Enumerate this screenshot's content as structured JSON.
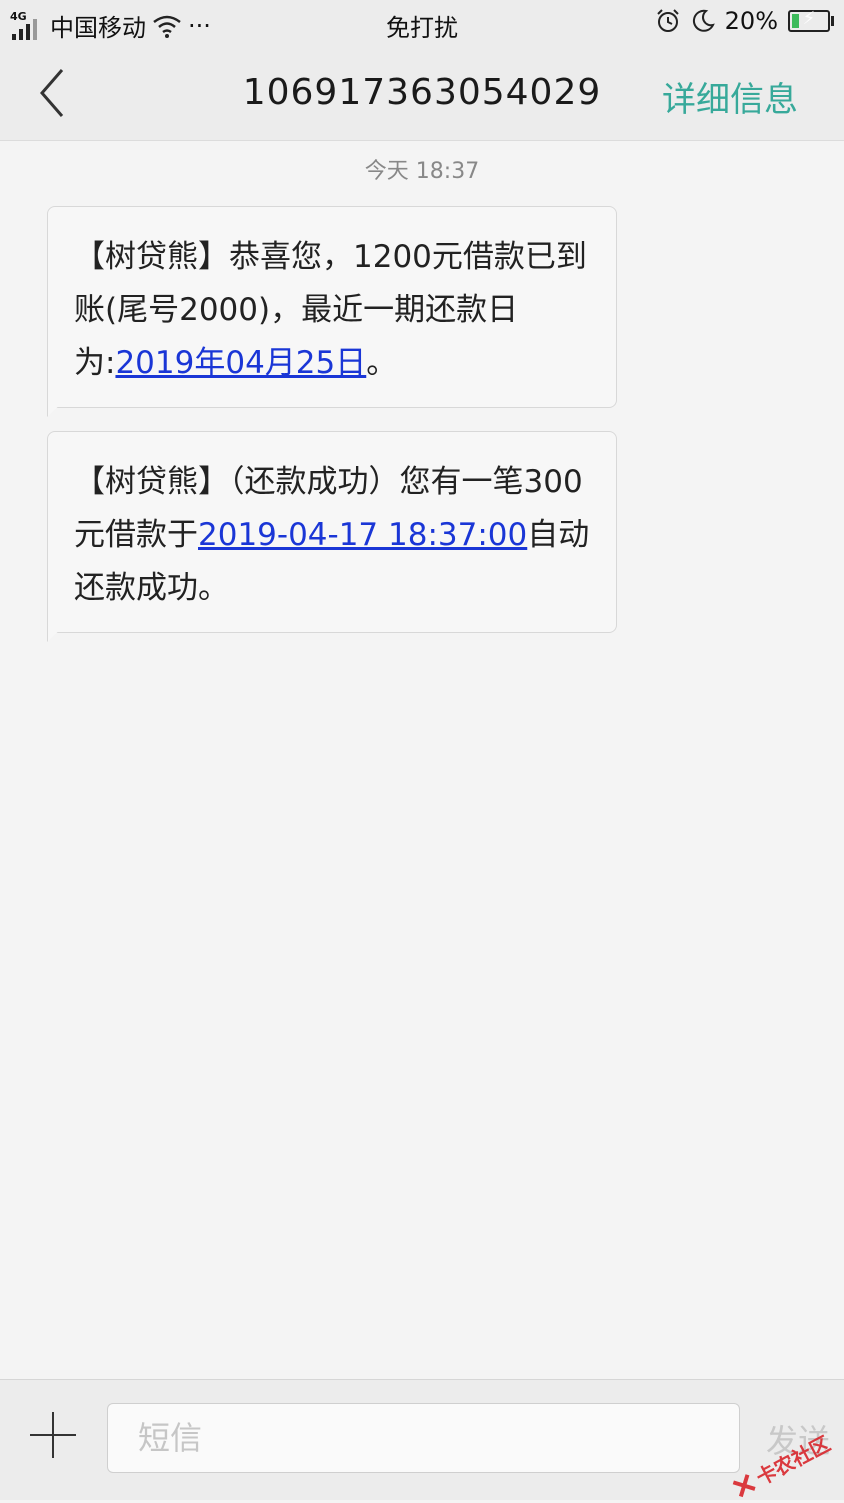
{
  "status_bar": {
    "network": "4G",
    "carrier": "中国移动",
    "more": "···",
    "mode": "免打扰",
    "battery": "20%",
    "battery_level": 0.2
  },
  "header": {
    "title": "106917363054029",
    "action": "详细信息"
  },
  "thread": {
    "date_label": "今天 18:37",
    "messages": [
      {
        "prefix": "【树贷熊】恭喜您，1200元借款已到账(尾号2000)，最近一期还款日为:",
        "link": "2019年04月25日",
        "suffix": "。"
      },
      {
        "prefix": "【树贷熊】（还款成功）您有一笔300元借款于",
        "link": "2019-04-17 18:37:00",
        "suffix": "自动还款成功。"
      }
    ]
  },
  "composer": {
    "placeholder": "短信",
    "send_label": "发送"
  },
  "watermark": {
    "text": "卡农社区"
  },
  "colors": {
    "accent": "#37a99a",
    "link": "#1a36d6",
    "battery": "#3dbb5c",
    "watermark": "#d9262c"
  }
}
